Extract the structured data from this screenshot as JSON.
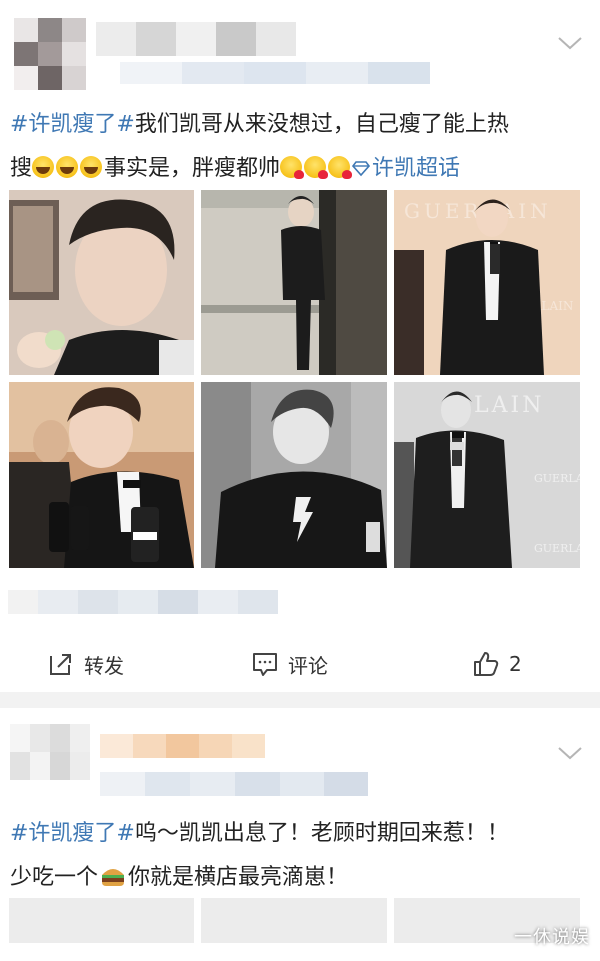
{
  "post1": {
    "text_topic": "#许凯瘦了#",
    "text_line1": "我们凯哥从来没想过，自己瘦了能上热",
    "text_line2a": "搜",
    "text_line2b": "事实是，胖瘦都帅",
    "super_topic": "许凯超话",
    "images": [
      {
        "name": "selfie-closeup",
        "tone": "warm"
      },
      {
        "name": "black-suit-doorway",
        "tone": "muted"
      },
      {
        "name": "tuxedo-microphone",
        "tone": "peach"
      },
      {
        "name": "bowtie-interview",
        "tone": "warm-dark"
      },
      {
        "name": "black-tee-portrait",
        "tone": "gray"
      },
      {
        "name": "tuxedo-event-bw",
        "tone": "gray-light"
      }
    ],
    "actions": {
      "repost_label": "转发",
      "comment_label": "评论",
      "like_count": "2"
    }
  },
  "post2": {
    "text_topic": "#许凯瘦了#",
    "text_line1": "呜～凯凯出息了！老顾时期回来惹！！",
    "text_line2a": "少吃一个",
    "text_line2b": "你就是横店最亮滴崽！"
  },
  "watermark": "一休说娱",
  "colors": {
    "topic_blue": "#3f78b4",
    "background": "#f2f2f2",
    "card": "#ffffff"
  },
  "icons": [
    "chevron-down-icon",
    "repost-icon",
    "comment-icon",
    "like-icon",
    "super-topic-diamond-icon",
    "laughing-emoji-icon",
    "kiss-emoji-icon",
    "burger-emoji-icon"
  ]
}
